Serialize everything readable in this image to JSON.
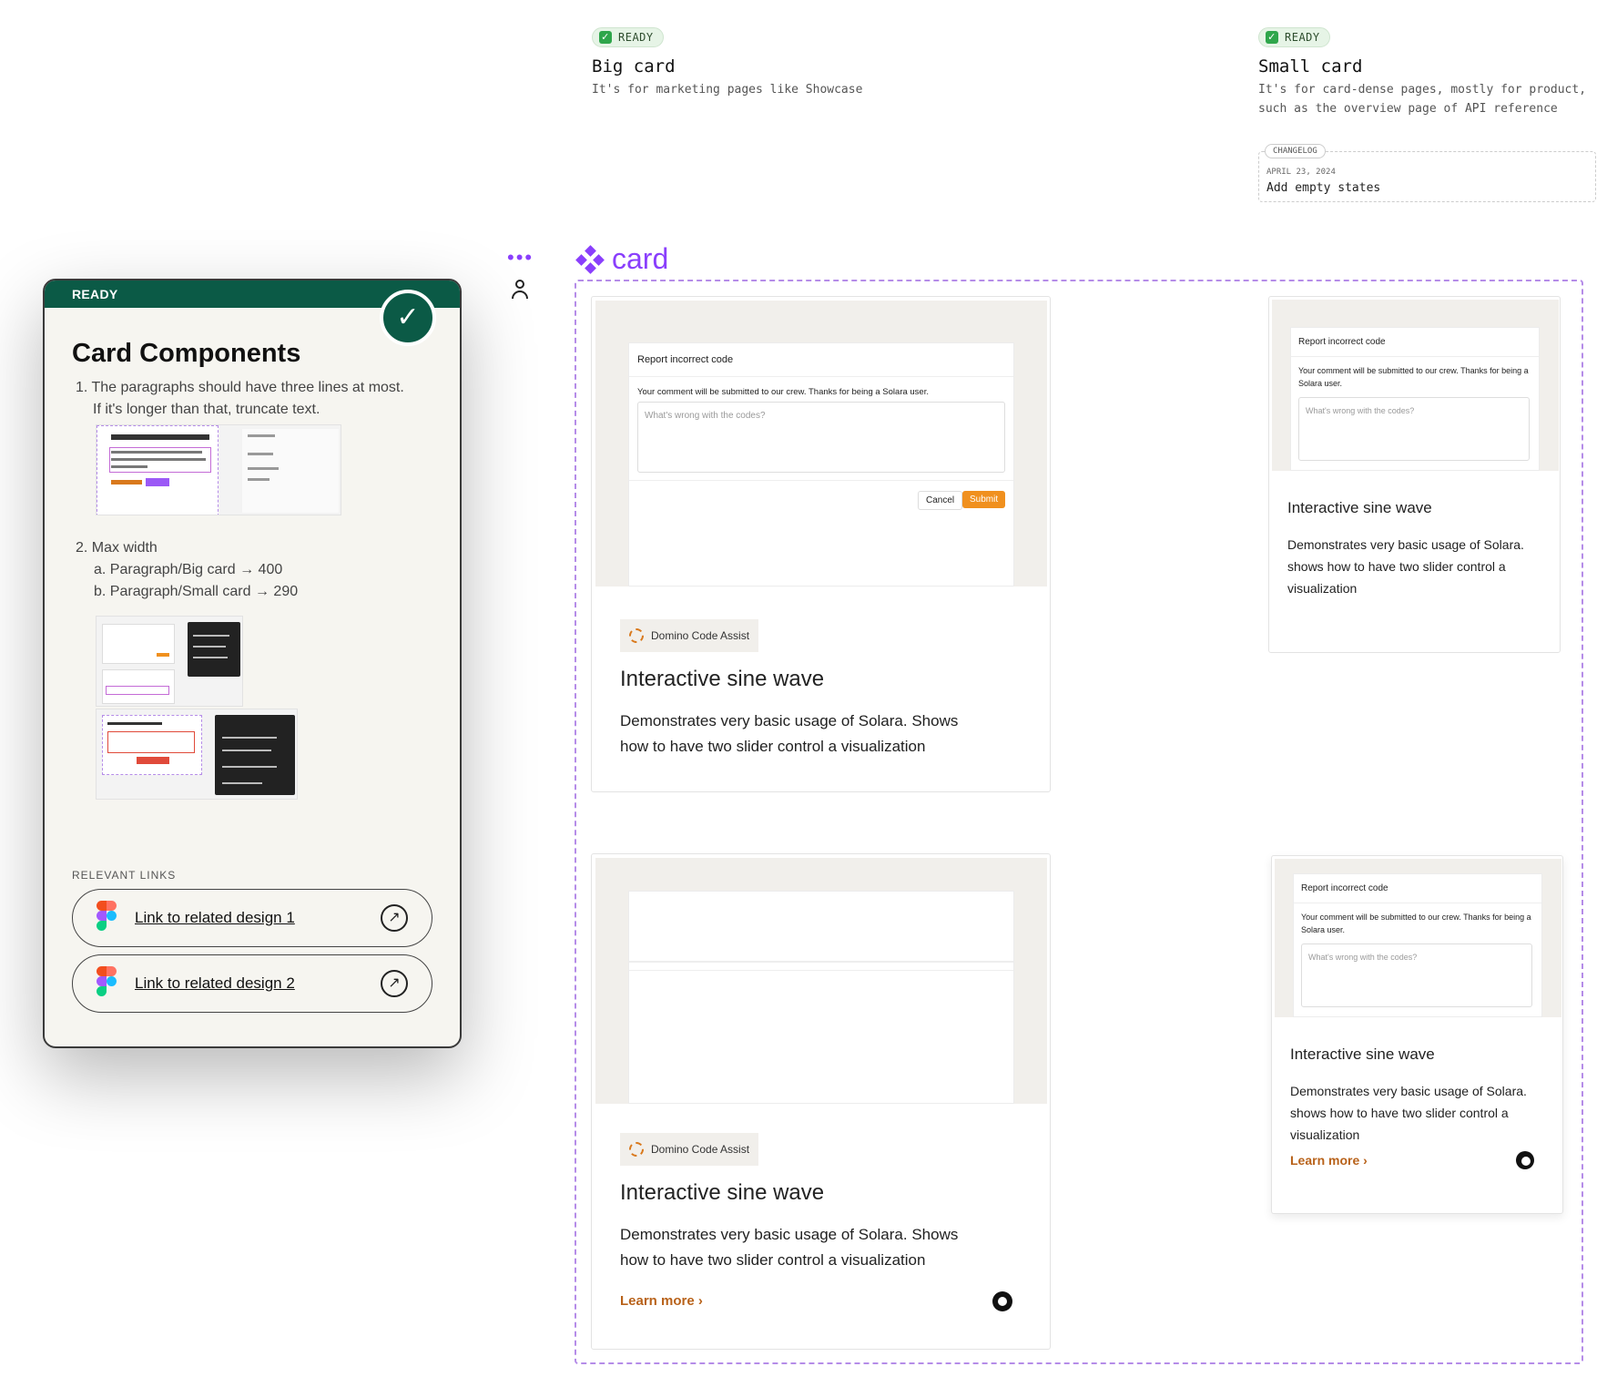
{
  "top": {
    "big": {
      "status": "READY",
      "title": "Big card",
      "desc": "It's for marketing pages like Showcase"
    },
    "small": {
      "status": "READY",
      "title": "Small card",
      "desc1": "It's for card-dense pages, mostly for product,",
      "desc2": "such as the overview page of API reference"
    },
    "changelog": {
      "tag": "CHANGELOG",
      "date": "APRIL 23, 2024",
      "entry": "Add empty states"
    }
  },
  "panel": {
    "status": "READY",
    "title": "Card Components",
    "rule1_num": "1.",
    "rule1_line1": "The paragraphs should have three lines at most.",
    "rule1_line2": "If it's longer than that, truncate text.",
    "rule2_num": "2.",
    "rule2": "Max width",
    "rule2a": "a. Paragraph/Big card → 400",
    "rule2b": "b. Paragraph/Small card → 290",
    "links_heading": "RELEVANT LINKS",
    "links": [
      {
        "label": "Link to related design 1"
      },
      {
        "label": "Link to related design 2"
      }
    ]
  },
  "component": {
    "name": "card"
  },
  "dialog": {
    "title": "Report incorrect code",
    "text": "Your comment will be submitted to our crew. Thanks for being a Solara user.",
    "placeholder": "What's wrong with the codes?",
    "cancel": "Cancel",
    "submit": "Submit"
  },
  "card": {
    "tag": "Domino Code Assist",
    "title": "Interactive sine wave",
    "desc_big": "Demonstrates very basic usage of Solara. Shows how to have two slider control a visualization",
    "desc_small": "Demonstrates very basic usage of Solara. shows how to have two slider control a visualization",
    "learn_more": "Learn more"
  },
  "colors": {
    "ready_green": "#0b5a46",
    "accent_orange": "#f0901e",
    "component_purple": "#8a3ffc",
    "link_orange": "#b8621a"
  }
}
